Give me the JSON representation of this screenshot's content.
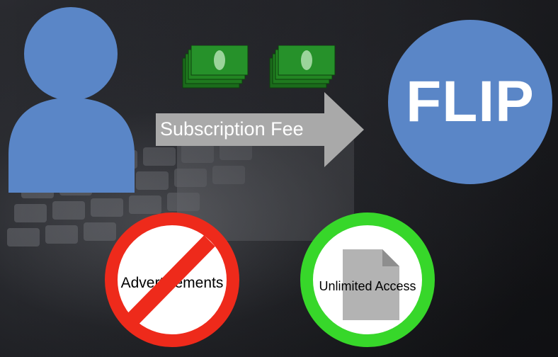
{
  "diagram": {
    "arrow_label": "Subscription Fee",
    "logo_text": "FLIP",
    "left_badge_label": "Advertisements",
    "right_badge_label": "Unlimited Access"
  },
  "colors": {
    "user_blue": "#5a86c7",
    "logo_blue": "#5a86c7",
    "arrow_gray": "#a9a9a9",
    "money_green": "#1f7a1f",
    "no_sign_red": "#ee2a1b",
    "access_green": "#37d72a",
    "document_gray": "#b3b3b3"
  },
  "icons": {
    "user": "user-silhouette-icon",
    "money": "cash-stack-icon",
    "arrow": "right-arrow-icon",
    "no": "prohibition-icon",
    "document": "document-icon"
  }
}
